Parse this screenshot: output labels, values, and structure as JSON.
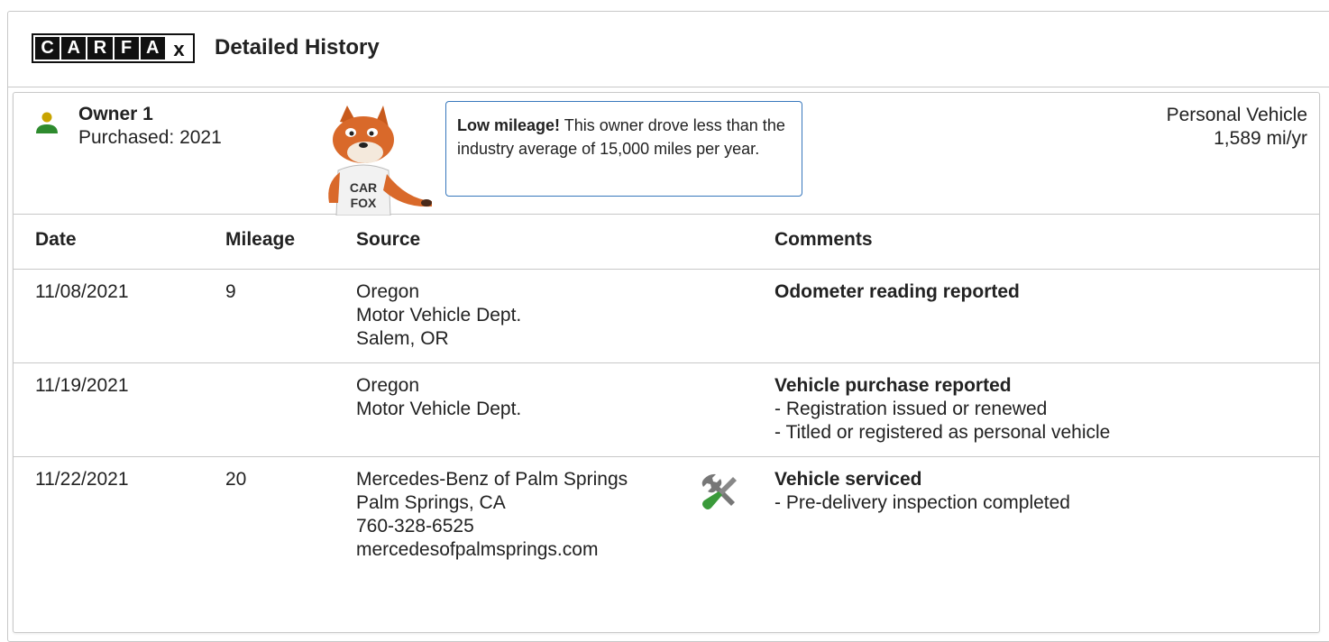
{
  "header": {
    "logo_letters": [
      "C",
      "A",
      "R",
      "F",
      "A",
      "x"
    ],
    "title": "Detailed History"
  },
  "owner": {
    "name": "Owner 1",
    "purchased": "Purchased: 2021",
    "callout_bold": "Low mileage!",
    "callout_text": " This owner drove less than the industry average of 15,000 miles per year.",
    "usage_type": "Personal Vehicle",
    "usage_rate": "1,589 mi/yr",
    "icon": "person-icon",
    "mascot_text": [
      "CAR",
      "FOX"
    ]
  },
  "table": {
    "headers": {
      "date": "Date",
      "mileage": "Mileage",
      "source": "Source",
      "comments": "Comments"
    },
    "rows": [
      {
        "date": "11/08/2021",
        "mileage": "9",
        "source": [
          "Oregon",
          "Motor Vehicle Dept.",
          "Salem, OR"
        ],
        "comment_title": "Odometer reading reported",
        "comment_items": []
      },
      {
        "date": "11/19/2021",
        "mileage": "",
        "source": [
          "Oregon",
          "Motor Vehicle Dept."
        ],
        "comment_title": "Vehicle purchase reported",
        "comment_items": [
          "- Registration issued or renewed",
          "- Titled or registered as personal vehicle"
        ]
      },
      {
        "date": "11/22/2021",
        "mileage": "20",
        "source": [
          "Mercedes-Benz of Palm Springs",
          "Palm Springs, CA",
          "760-328-6525",
          "mercedesofpalmsprings.com"
        ],
        "source_icon": "wrench-screwdriver-icon",
        "comment_title": "Vehicle serviced",
        "comment_items": [
          "- Pre-delivery inspection completed"
        ]
      }
    ]
  },
  "colors": {
    "border": "#c8c8c8",
    "callout_border": "#3777bc",
    "person_head": "#c8a400",
    "person_body": "#2e8b2e",
    "tool_green": "#3a9a3a",
    "tool_gray": "#777777"
  }
}
